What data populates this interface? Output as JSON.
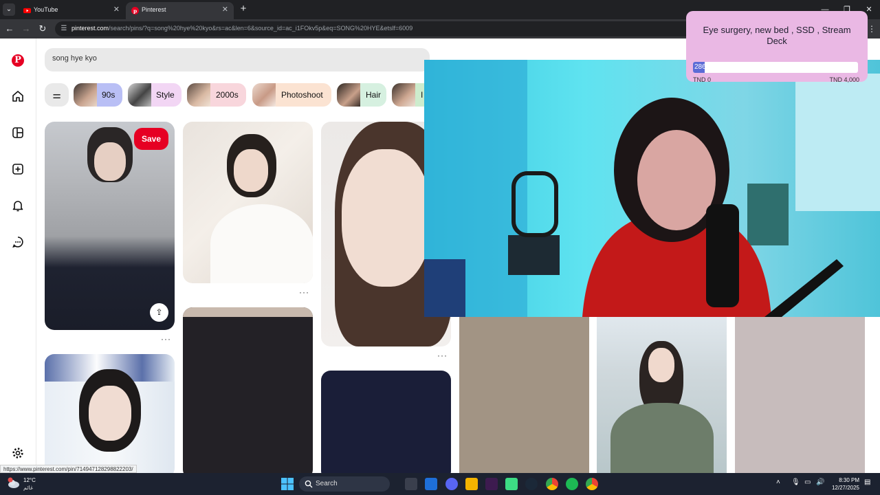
{
  "browser": {
    "tabs": [
      {
        "title": "YouTube",
        "icon": "youtube-icon",
        "active": false
      },
      {
        "title": "Pinterest",
        "icon": "pinterest-icon",
        "active": true
      }
    ],
    "url_host": "pinterest.com",
    "url_path": "/search/pins/?q=song%20hye%20kyo&rs=ac&len=6&source_id=ac_i1FOkv5p&eq=SONG%20HYE&etslf=6009"
  },
  "pinterest": {
    "search_value": "song hye kyo",
    "chips": [
      "90s",
      "Style",
      "2000s",
      "Photoshoot",
      "Hair",
      "I"
    ],
    "save_label": "Save",
    "status_url": "https://www.pinterest.com/pin/714947128298822203/"
  },
  "goal": {
    "title": "Eye surgery, new bed , SSD , Stream Deck",
    "current": "286",
    "current_value": 286,
    "max_value": 4000,
    "min_label": "TND 0",
    "max_label": "TND 4,000"
  },
  "taskbar": {
    "temperature": "12°C",
    "condition": "غائم",
    "search_label": "Search",
    "time": "8:30 PM",
    "date": "12/27/2025"
  },
  "colors": {
    "pinterest_red": "#e60023",
    "goal_bg": "#eab8e4",
    "goal_fill": "#5b6bd6"
  }
}
